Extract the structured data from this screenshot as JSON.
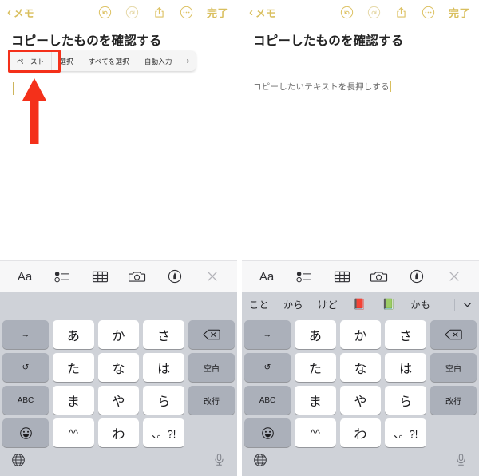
{
  "meta": {
    "description": "iOS Notes app screenshot pair showing copy/paste instructions in Japanese",
    "accent_gold": "#d9bf5e",
    "highlight_red": "#f4301a",
    "keyboard_bg": "#cfd2d8",
    "key_light": "#ffffff",
    "key_dark": "#abb0ba"
  },
  "panels": [
    {
      "id": "left",
      "navbar": {
        "back_label": "メモ",
        "back_icon": "chevron-left-icon",
        "icons": [
          "undo-icon",
          "redo-icon",
          "share-icon",
          "more-icon"
        ],
        "done_label": "完了"
      },
      "note": {
        "title": "コピーしたものを確認する",
        "body": "",
        "has_caret": true
      },
      "edit_menu": {
        "visible": true,
        "items": [
          "ペースト",
          "選択",
          "すべてを選択",
          "自動入力"
        ],
        "more_chevron": "›",
        "highlighted_item": "ペースト"
      },
      "annotation": {
        "arrow": "red-up-arrow",
        "arrow_color": "#f4301a",
        "box_color": "#f4301a"
      },
      "keyboard": {
        "toolbar": [
          "Aa",
          "checklist-icon",
          "table-icon",
          "camera-icon",
          "markup-pen-icon",
          "close-icon"
        ],
        "suggestions": []
      }
    },
    {
      "id": "right",
      "navbar": {
        "back_label": "メモ",
        "back_icon": "chevron-left-icon",
        "icons": [
          "undo-icon",
          "redo-icon",
          "share-icon",
          "more-icon"
        ],
        "done_label": "完了"
      },
      "note": {
        "title": "コピーしたものを確認する",
        "body": "コピーしたいテキストを長押しする",
        "has_caret": true
      },
      "edit_menu": {
        "visible": false,
        "items": [],
        "more_chevron": "",
        "highlighted_item": ""
      },
      "annotation": {
        "arrow": "",
        "arrow_color": "",
        "box_color": ""
      },
      "keyboard": {
        "toolbar": [
          "Aa",
          "checklist-icon",
          "table-icon",
          "camera-icon",
          "markup-pen-icon",
          "close-icon"
        ],
        "suggestions": [
          "こと",
          "から",
          "けど",
          "📕",
          "📗",
          "かも"
        ],
        "suggestions_chevron": "chevron-down-icon"
      }
    }
  ],
  "keyboard_layout": {
    "toolbar_labels": {
      "text_format": "Aa"
    },
    "rows": [
      {
        "left": "→",
        "chars": [
          "あ",
          "か",
          "さ"
        ],
        "right": "delete-icon"
      },
      {
        "left": "↺",
        "chars": [
          "た",
          "な",
          "は"
        ],
        "right": "空白"
      },
      {
        "left": "ABC",
        "chars": [
          "ま",
          "や",
          "ら"
        ],
        "right": "改行"
      },
      {
        "left": "emoji-icon",
        "chars": [
          "^^",
          "わ",
          "、。?!"
        ],
        "right": ""
      }
    ],
    "bottom": {
      "globe": "globe-icon",
      "mic": "microphone-icon"
    }
  }
}
